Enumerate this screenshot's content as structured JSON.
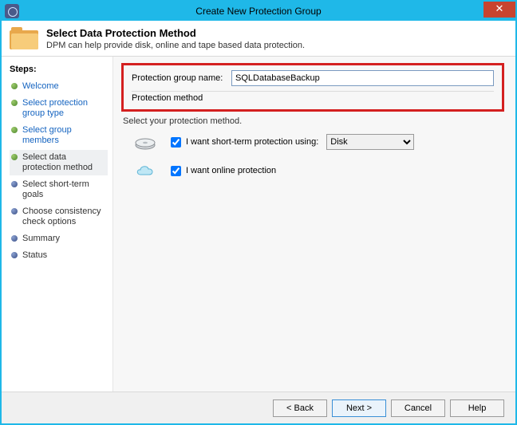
{
  "window": {
    "title": "Create New Protection Group",
    "close_glyph": "✕"
  },
  "header": {
    "title": "Select Data Protection Method",
    "subtitle": "DPM can help provide disk, online and tape based data protection."
  },
  "sidebar": {
    "heading": "Steps:",
    "steps": [
      {
        "label": "Welcome",
        "state": "done"
      },
      {
        "label": "Select protection group type",
        "state": "done"
      },
      {
        "label": "Select group members",
        "state": "done"
      },
      {
        "label": "Select data protection method",
        "state": "current"
      },
      {
        "label": "Select short-term goals",
        "state": "upcoming"
      },
      {
        "label": "Choose consistency check options",
        "state": "upcoming"
      },
      {
        "label": "Summary",
        "state": "upcoming"
      },
      {
        "label": "Status",
        "state": "upcoming"
      }
    ]
  },
  "form": {
    "group_name_label": "Protection group name:",
    "group_name_value": "SQLDatabaseBackup",
    "method_heading": "Protection method",
    "instruction": "Select your protection method.",
    "short_term_label": "I want short-term protection using:",
    "short_term_checked": true,
    "disk_options": [
      "Disk"
    ],
    "disk_selected": "Disk",
    "online_label": "I want online protection",
    "online_checked": true
  },
  "footer": {
    "back": "< Back",
    "next": "Next >",
    "cancel": "Cancel",
    "help": "Help"
  }
}
